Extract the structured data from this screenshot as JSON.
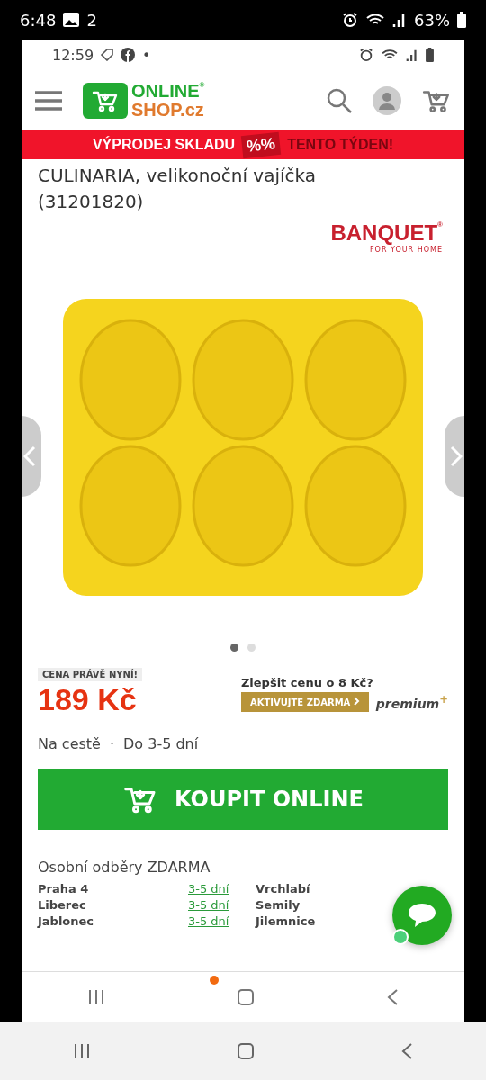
{
  "outer_status_bar": {
    "time": "6:48",
    "notification_count": "2",
    "battery": "63%"
  },
  "inner_status_bar": {
    "time": "12:59",
    "dot": "•"
  },
  "header": {
    "logo_top": "ONLINE",
    "logo_bottom": "SHOP.cz",
    "logo_mark": "®"
  },
  "promo_banner": {
    "left": "VÝPRODEJ SKLADU",
    "badge": "%%",
    "right": "TENTO TÝDEN!"
  },
  "product": {
    "title": "CULINARIA, velikonoční vajíčka (31201820)",
    "brand": "BANQUET",
    "brand_mark": "®",
    "brand_tagline": "FOR YOUR HOME"
  },
  "carousel_dots": [
    {
      "selected": true
    },
    {
      "selected": false
    }
  ],
  "price": {
    "label": "CENA PRÁVĚ NYNÍ!",
    "amount": "189 Kč",
    "upsell": "Zlepšit cenu o 8 Kč?",
    "activate_button": "AKTIVUJTE ZDARMA",
    "premium": "premium",
    "premium_mark": "+"
  },
  "availability": {
    "status": "Na cestě",
    "separator": "·",
    "delivery": "Do 3-5 dní"
  },
  "buy_button": "KOUPIT ONLINE",
  "pickup": {
    "title": "Osobní odběry ZDARMA",
    "rows": [
      {
        "left_city": "Praha 4",
        "left_time": "3-5 dní",
        "right_city": "Vrchlabí"
      },
      {
        "left_city": "Liberec",
        "left_time": "3-5 dní",
        "right_city": "Semily"
      },
      {
        "left_city": "Jablonec",
        "left_time": "3-5 dní",
        "right_city": "Jilemnice"
      }
    ]
  }
}
